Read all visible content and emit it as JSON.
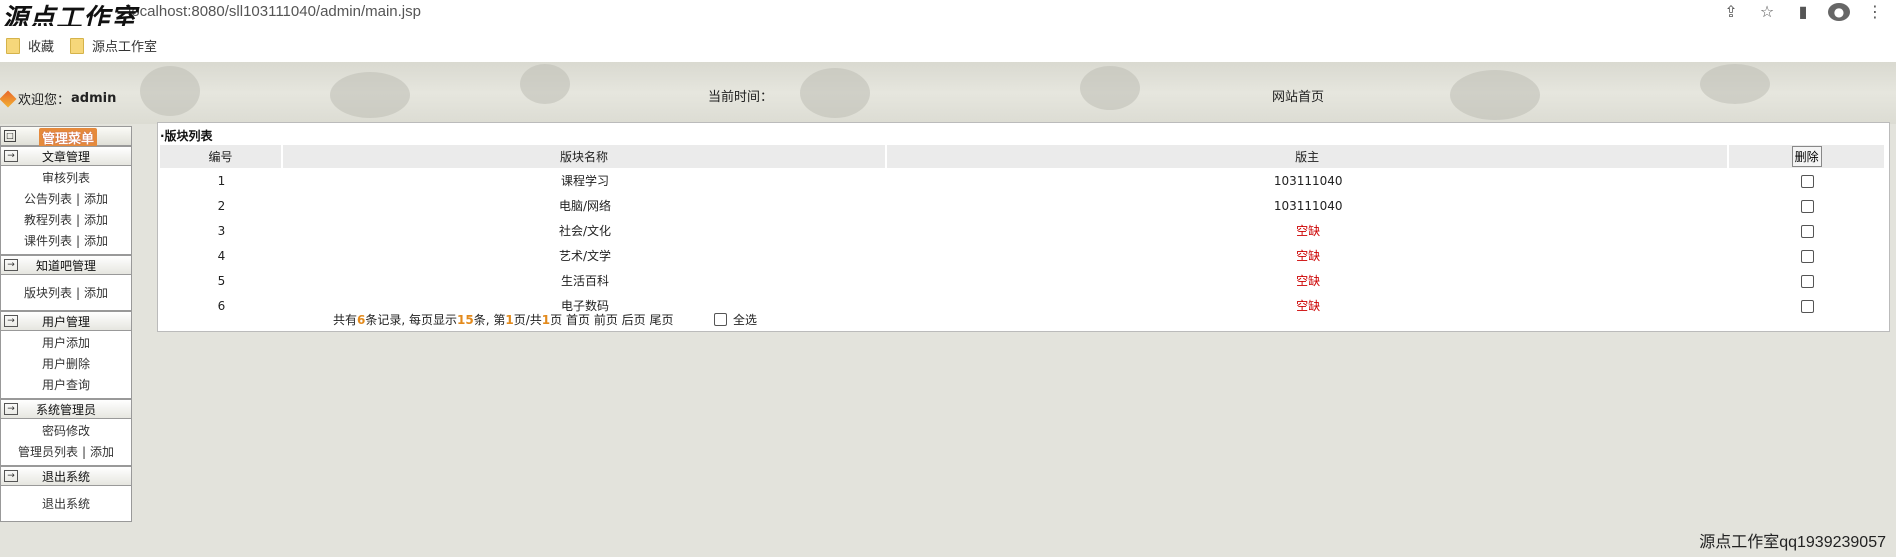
{
  "browser": {
    "url": "localhost:8080/sll103111040/admin/main.jsp",
    "watermark": "源点工作室",
    "bookmarks": [
      "收藏",
      "源点工作室"
    ]
  },
  "header": {
    "welcome_prefix": "欢迎您：",
    "username": "admin",
    "current_time_label": "当前时间：",
    "home_link": "网站首页"
  },
  "sidebar": {
    "menu_title": "管理菜单",
    "groups": [
      {
        "title": "文章管理",
        "items": [
          {
            "links": [
              "审核列表"
            ]
          },
          {
            "links": [
              "公告列表",
              "添加"
            ]
          },
          {
            "links": [
              "教程列表",
              "添加"
            ]
          },
          {
            "links": [
              "课件列表",
              "添加"
            ]
          }
        ]
      },
      {
        "title": "知道吧管理",
        "items": [
          {
            "links": [
              "版块列表",
              "添加"
            ]
          }
        ]
      },
      {
        "title": "用户管理",
        "items": [
          {
            "links": [
              "用户添加"
            ]
          },
          {
            "links": [
              "用户删除"
            ]
          },
          {
            "links": [
              "用户查询"
            ]
          }
        ]
      },
      {
        "title": "系统管理员",
        "items": [
          {
            "links": [
              "密码修改"
            ]
          },
          {
            "links": [
              "管理员列表",
              "添加"
            ]
          }
        ]
      },
      {
        "title": "退出系统",
        "items": [
          {
            "links": [
              "退出系统"
            ]
          }
        ]
      }
    ],
    "separator": "|"
  },
  "panel": {
    "title": "·版块列表",
    "columns": [
      "编号",
      "版块名称",
      "版主"
    ],
    "delete_label": "删除",
    "rows": [
      {
        "id": "1",
        "name": "课程学习",
        "moderator": "103111040",
        "vacant": false
      },
      {
        "id": "2",
        "name": "电脑/网络",
        "moderator": "103111040",
        "vacant": false
      },
      {
        "id": "3",
        "name": "社会/文化",
        "moderator": "空缺",
        "vacant": true
      },
      {
        "id": "4",
        "name": "艺术/文学",
        "moderator": "空缺",
        "vacant": true
      },
      {
        "id": "5",
        "name": "生活百科",
        "moderator": "空缺",
        "vacant": true
      },
      {
        "id": "6",
        "name": "电子数码",
        "moderator": "空缺",
        "vacant": true
      }
    ],
    "pager": {
      "t1": "共有",
      "total": "6",
      "t2": "条记录, 每页显示",
      "per_page": "15",
      "t3": "条, 第",
      "page": "1",
      "t4": "页/共",
      "pages": "1",
      "t5": "页",
      "first": "首页",
      "prev": "前页",
      "next": "后页",
      "last": "尾页"
    },
    "select_all": "全选"
  },
  "footer": "源点工作室qq1939239057",
  "colors": {
    "vacant": "#cc0000",
    "pager_number": "#e38a1c",
    "menu_accent": "#e58a3c"
  }
}
